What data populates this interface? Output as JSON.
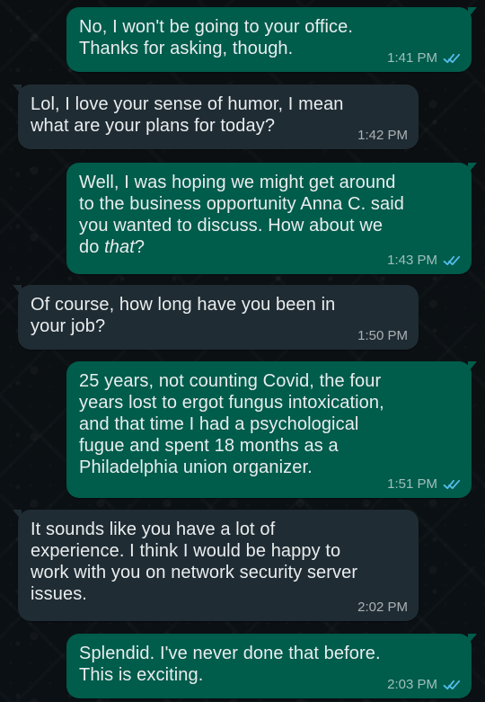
{
  "conversation": {
    "messages": [
      {
        "side": "outgoing",
        "text": "No, I won't be going to your office.\nThanks for asking, though.",
        "time": "1:41 PM",
        "status_icon": "double-check-read-icon"
      },
      {
        "side": "incoming",
        "text": "Lol, I love your sense of humor, I mean\nwhat are your plans for today?",
        "time": "1:42 PM"
      },
      {
        "side": "outgoing",
        "text_prefix": "Well, I was hoping we might get around\nto the business opportunity Anna C. said\nyou wanted to discuss.  How about we\ndo ",
        "text_emphasis": "that",
        "text_suffix": "?",
        "time": "1:43 PM",
        "status_icon": "double-check-read-icon"
      },
      {
        "side": "incoming",
        "text": "Of course, how long have you been in\nyour job?",
        "time": "1:50 PM"
      },
      {
        "side": "outgoing",
        "text": "25 years, not counting Covid, the four\nyears lost to ergot fungus intoxication,\nand that time I had a psychological\nfugue and spent 18 months as a\nPhiladelphia union organizer.",
        "time": "1:51 PM",
        "status_icon": "double-check-read-icon"
      },
      {
        "side": "incoming",
        "text": "It sounds like you have a lot of\nexperience. I think I would be happy to\nwork with you on network security server\nissues.",
        "time": "2:02 PM"
      },
      {
        "side": "outgoing",
        "text": "Splendid.  I've never done that before.\nThis is exciting.",
        "time": "2:03 PM",
        "status_icon": "double-check-read-icon"
      }
    ]
  },
  "colors": {
    "background": "#0b1014",
    "incoming_bubble": "#202c33",
    "outgoing_bubble": "#005c4b",
    "text": "#e9edef",
    "timestamp": "#aebac1",
    "read_receipt": "#53bdeb"
  }
}
